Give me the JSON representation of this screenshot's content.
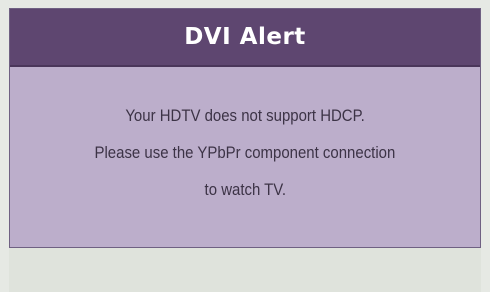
{
  "dialog": {
    "title": "DVI Alert",
    "message_lines": [
      "Your HDTV does not support HDCP.",
      "Please use the YPbPr component connection",
      "to watch TV."
    ]
  },
  "colors": {
    "title_bar": "#5e4670",
    "dialog_body": "#bcaecb",
    "background": "#e6e9e4",
    "title_text": "#ffffff",
    "message_text": "#3c3346"
  }
}
